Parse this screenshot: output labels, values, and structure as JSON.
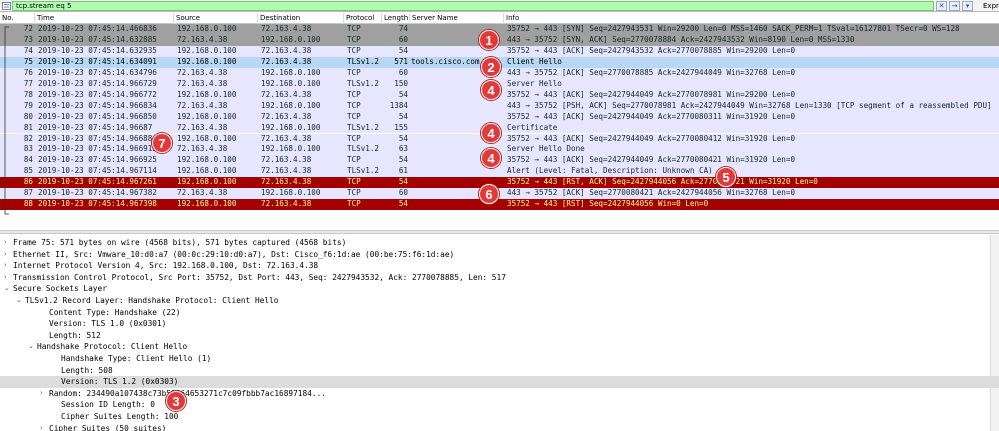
{
  "filter": {
    "value": "tcp.stream eq 5",
    "expression_label": "Expre",
    "close_glyph": "✕",
    "arrow_glyph": "→",
    "bookmark_glyph": "▾"
  },
  "columns": [
    "No.",
    "Time",
    "Source",
    "Destination",
    "Protocol",
    "Length",
    "Server Name",
    "Info"
  ],
  "packets": [
    {
      "no": "72",
      "time": "2019-10-23 07:45:14.466836",
      "src": "192.168.0.100",
      "dst": "72.163.4.38",
      "proto": "TCP",
      "len": "74",
      "server": "",
      "info": "35752 → 443 [SYN] Seq=2427943531 Win=29200 Len=0 MSS=1460 SACK_PERM=1 TSval=16127801 TSecr=0 WS=128",
      "style": "tcpgray"
    },
    {
      "no": "73",
      "time": "2019-10-23 07:45:14.632885",
      "src": "72.163.4.38",
      "dst": "192.168.0.100",
      "proto": "TCP",
      "len": "60",
      "server": "",
      "info": "443 → 35752 [SYN, ACK] Seq=2770078884 Ack=2427943532 Win=8190 Len=0 MSS=1330",
      "style": "tcpgray"
    },
    {
      "no": "74",
      "time": "2019-10-23 07:45:14.632935",
      "src": "192.168.0.100",
      "dst": "72.163.4.38",
      "proto": "TCP",
      "len": "54",
      "server": "",
      "info": "35752 → 443 [ACK] Seq=2427943532 Ack=2770078885 Win=29200 Len=0",
      "style": "tcp"
    },
    {
      "no": "75",
      "time": "2019-10-23 07:45:14.634091",
      "src": "192.168.0.100",
      "dst": "72.163.4.38",
      "proto": "TLSv1.2",
      "len": "571",
      "server": "tools.cisco.com",
      "info": "Client Hello",
      "style": "sel"
    },
    {
      "no": "76",
      "time": "2019-10-23 07:45:14.634796",
      "src": "72.163.4.38",
      "dst": "192.168.0.100",
      "proto": "TCP",
      "len": "60",
      "server": "",
      "info": "443 → 35752 [ACK] Seq=2770078885 Ack=2427944049 Win=32768 Len=0",
      "style": "tcp"
    },
    {
      "no": "77",
      "time": "2019-10-23 07:45:14.966729",
      "src": "72.163.4.38",
      "dst": "192.168.0.100",
      "proto": "TLSv1.2",
      "len": "150",
      "server": "",
      "info": "Server Hello",
      "style": "tls"
    },
    {
      "no": "78",
      "time": "2019-10-23 07:45:14.966772",
      "src": "192.168.0.100",
      "dst": "72.163.4.38",
      "proto": "TCP",
      "len": "54",
      "server": "",
      "info": "35752 → 443 [ACK] Seq=2427944049 Ack=2770078981 Win=29200 Len=0",
      "style": "tcp"
    },
    {
      "no": "79",
      "time": "2019-10-23 07:45:14.966834",
      "src": "72.163.4.38",
      "dst": "192.168.0.100",
      "proto": "TCP",
      "len": "1384",
      "server": "",
      "info": "443 → 35752 [PSH, ACK] Seq=2770078981 Ack=2427944049 Win=32768 Len=1330 [TCP segment of a reassembled PDU]",
      "style": "tcp"
    },
    {
      "no": "80",
      "time": "2019-10-23 07:45:14.966850",
      "src": "192.168.0.100",
      "dst": "72.163.4.38",
      "proto": "TCP",
      "len": "54",
      "server": "",
      "info": "35752 → 443 [ACK] Seq=2427944049 Ack=2770080311 Win=31920 Len=0",
      "style": "tcp"
    },
    {
      "no": "81",
      "time": "2019-10-23 07:45:14.96687",
      "src": "72.163.4.38",
      "dst": "192.168.0.100",
      "proto": "TLSv1.2",
      "len": "155",
      "server": "",
      "info": "Certificate",
      "style": "tls"
    },
    {
      "no": "82",
      "time": "2019-10-23 07:45:14.96688",
      "src": "192.168.0.100",
      "dst": "72.163.4.38",
      "proto": "TCP",
      "len": "54",
      "server": "",
      "info": "35752 → 443 [ACK] Seq=2427944049 Ack=2770080412 Win=31920 Len=0",
      "style": "tcp"
    },
    {
      "no": "83",
      "time": "2019-10-23 07:45:14.966915",
      "src": "72.163.4.38",
      "dst": "192.168.0.100",
      "proto": "TLSv1.2",
      "len": "63",
      "server": "",
      "info": "Server Hello Done",
      "style": "tls"
    },
    {
      "no": "84",
      "time": "2019-10-23 07:45:14.966925",
      "src": "192.168.0.100",
      "dst": "72.163.4.38",
      "proto": "TCP",
      "len": "54",
      "server": "",
      "info": "35752 → 443 [ACK] Seq=2427944049 Ack=2770080421 Win=31920 Len=0",
      "style": "tcp"
    },
    {
      "no": "85",
      "time": "2019-10-23 07:45:14.967114",
      "src": "192.168.0.100",
      "dst": "72.163.4.38",
      "proto": "TLSv1.2",
      "len": "61",
      "server": "",
      "info": "Alert (Level: Fatal, Description: Unknown CA)",
      "style": "tls"
    },
    {
      "no": "86",
      "time": "2019-10-23 07:45:14.967261",
      "src": "192.168.0.100",
      "dst": "72.163.4.38",
      "proto": "TCP",
      "len": "54",
      "server": "",
      "info": "35752 → 443 [RST, ACK] Seq=2427944056 Ack=2770080421 Win=31920 Len=0",
      "style": "rst"
    },
    {
      "no": "87",
      "time": "2019-10-23 07:45:14.967382",
      "src": "72.163.4.38",
      "dst": "192.168.0.100",
      "proto": "TCP",
      "len": "60",
      "server": "",
      "info": "443 → 35752 [ACK] Seq=2770080421 Ack=2427944056 Win=32768 Len=0",
      "style": "tcp"
    },
    {
      "no": "88",
      "time": "2019-10-23 07:45:14.967398",
      "src": "192.168.0.100",
      "dst": "72.163.4.38",
      "proto": "TCP",
      "len": "54",
      "server": "",
      "info": "35752 → 443 [RST] Seq=2427944056 Win=0 Len=0",
      "style": "rst"
    }
  ],
  "markers": [
    "1",
    "2",
    "3",
    "4",
    "4",
    "4",
    "5",
    "6",
    "7"
  ],
  "details": [
    {
      "text": "Frame 75: 571 bytes on wire (4568 bits), 571 bytes captured (4568 bits)",
      "arrow": "›",
      "hl": false
    },
    {
      "text": "Ethernet II, Src: Vmware_10:d0:a7 (00:0c:29:10:d0:a7), Dst: Cisco_f6:1d:ae (00:be:75:f6:1d:ae)",
      "arrow": "›",
      "hl": false
    },
    {
      "text": "Internet Protocol Version 4, Src: 192.168.0.100, Dst: 72.163.4.38",
      "arrow": "›",
      "hl": false
    },
    {
      "text": "Transmission Control Protocol, Src Port: 35752, Dst Port: 443, Seq: 2427943532, Ack: 2770078885, Len: 517",
      "arrow": "›",
      "hl": false
    },
    {
      "text": "Secure Sockets Layer",
      "arrow": "⌄",
      "hl": false
    },
    {
      "text": "TLSv1.2 Record Layer: Handshake Protocol: Client Hello",
      "arrow": "⌄",
      "hl": false
    },
    {
      "text": "Content Type: Handshake (22)",
      "arrow": "",
      "hl": false
    },
    {
      "text": "Version: TLS 1.0 (0x0301)",
      "arrow": "",
      "hl": false
    },
    {
      "text": "Length: 512",
      "arrow": "",
      "hl": false
    },
    {
      "text": "Handshake Protocol: Client Hello",
      "arrow": "⌄",
      "hl": false
    },
    {
      "text": "Handshake Type: Client Hello (1)",
      "arrow": "",
      "hl": false
    },
    {
      "text": "Length: 508",
      "arrow": "",
      "hl": false
    },
    {
      "text": "Version: TLS 1.2 (0x0303)",
      "arrow": "",
      "hl": true
    },
    {
      "text": "Random: 234490a107438c73b59564653271c7c09fbbb7ac16897184...",
      "arrow": "›",
      "hl": false
    },
    {
      "text": "Session ID Length: 0",
      "arrow": "",
      "hl": false
    },
    {
      "text": "Cipher Suites Length: 100",
      "arrow": "",
      "hl": false
    },
    {
      "text": "Cipher Suites (50 suites)",
      "arrow": "›",
      "hl": false
    }
  ]
}
